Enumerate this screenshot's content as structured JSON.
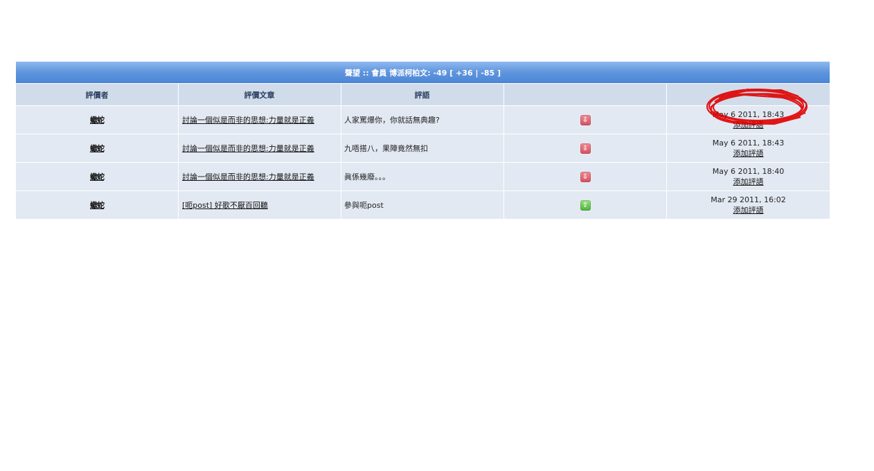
{
  "panel": {
    "title_prefix": "聲望 :: 會員",
    "member_name": "博派柯柏文",
    "score": ": -49",
    "breakdown": "[ +36 | -85 ]"
  },
  "columns": [
    "評價者",
    "評價文章",
    "評語",
    "",
    ""
  ],
  "rows": [
    {
      "giver": "蠍蛇",
      "post": "討論一個似是而非的思想:力量就是正義",
      "comment": "人家罵爆你，你就話無典趣?",
      "vote": "negative",
      "vote_icon": "arrow-down-icon",
      "date": "May 6 2011, 18:43",
      "action": "添加評語"
    },
    {
      "giver": "蠍蛇",
      "post": "討論一個似是而非的思想:力量就是正義",
      "comment": "九唔搭八，果陣竟然無扣",
      "vote": "negative",
      "vote_icon": "arrow-down-icon",
      "date": "May 6 2011, 18:43",
      "action": "添加評語"
    },
    {
      "giver": "蠍蛇",
      "post": "討論一個似是而非的思想:力量就是正義",
      "comment": "眞係幾廢。。。",
      "vote": "negative",
      "vote_icon": "arrow-down-icon",
      "date": "May 6 2011, 18:40",
      "action": "添加評語"
    },
    {
      "giver": "蠍蛇",
      "post": "[呃post] 好歌不厭百回聽",
      "comment": "參與呃post",
      "vote": "positive",
      "vote_icon": "arrow-up-icon",
      "date": "Mar 29 2011, 16:02",
      "action": "添加評語"
    }
  ],
  "colors": {
    "title_bar": "#5f95dd",
    "header_bg": "#d1dceb",
    "row_bg": "#e3e9f2",
    "negative_vote": "#d6505e",
    "positive_vote": "#4ab53a",
    "annotation": "#e00000"
  }
}
